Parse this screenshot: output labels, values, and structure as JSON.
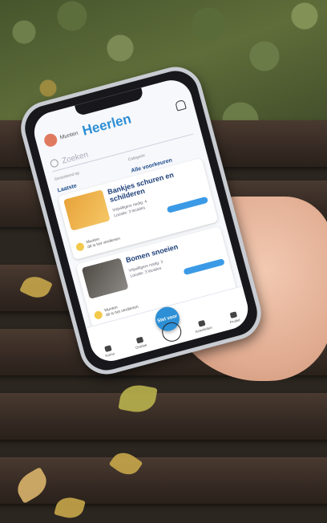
{
  "app": {
    "brand_small": "Munten",
    "city": "Heerlen",
    "search_placeholder": "Zoeken",
    "filters": [
      {
        "label": "Gesorteerd op",
        "value": "Laatste"
      },
      {
        "label": "Categorie",
        "value": "Alle voorkeuren"
      }
    ],
    "cards": [
      {
        "title": "Bankjes schuren en schilderen",
        "meta1": "Vrijwilligers nodig: 4",
        "meta2": "Locatie: 3 locaties",
        "owner": "Munten",
        "owner_sub": "dit is het verdienen"
      },
      {
        "title": "Bomen snoeien",
        "meta1": "Vrijwilligers nodig: 3",
        "meta2": "Locatie: 3 locaties",
        "owner": "Munten",
        "owner_sub": "dit is het verdienen"
      }
    ],
    "fab_label": "Stel voor",
    "tabs": [
      "Home",
      "Ontdek",
      "",
      "Activiteiten",
      "Profiel"
    ]
  },
  "colors": {
    "accent": "#2d8fd5",
    "title": "#1d3f78"
  }
}
